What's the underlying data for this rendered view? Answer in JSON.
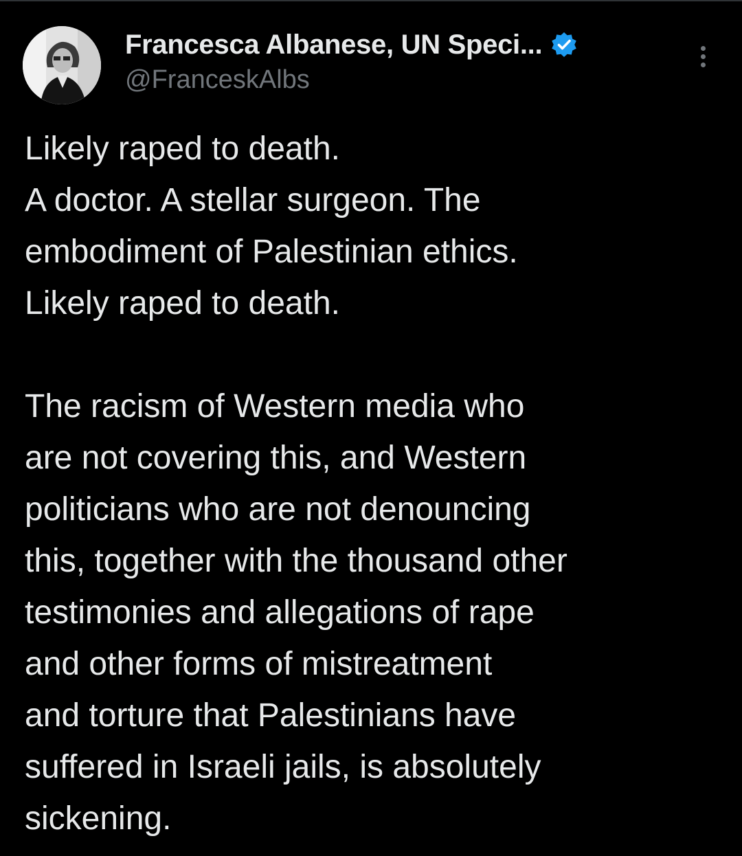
{
  "tweet": {
    "author": {
      "display_name": "Francesca Albanese, UN Speci...",
      "handle": "@FranceskAlbs",
      "verified": true,
      "verified_icon": "verified-badge-icon",
      "verified_color": "#1d9bf0"
    },
    "menu_icon": "more-vertical-icon",
    "paragraphs": [
      {
        "lines": [
          "Likely raped to death.",
          "A doctor. A stellar surgeon. The",
          "embodiment of Palestinian ethics.",
          "Likely raped to death."
        ]
      },
      {
        "lines": [
          "The racism of Western media who",
          "are not covering this, and Western",
          "politicians who are not denouncing",
          "this, together with the thousand other",
          "testimonies and allegations of rape",
          "and other forms of mistreatment",
          "and torture that Palestinians have",
          "suffered in Israeli jails, is absolutely",
          "sickening."
        ]
      }
    ]
  },
  "theme": {
    "background": "#000000",
    "text": "#e7e9ea",
    "secondary_text": "#71767b"
  }
}
